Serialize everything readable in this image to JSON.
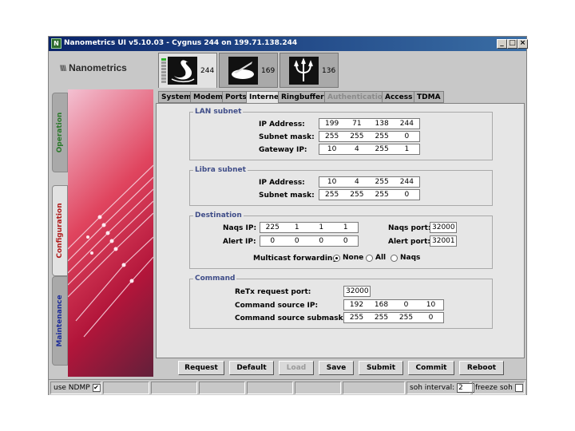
{
  "window": {
    "title": "Nanometrics UI v5.10.03 - Cygnus 244 on 199.71.138.244",
    "controls": {
      "minimize": "_",
      "maximize": "□",
      "close": "×"
    }
  },
  "logo": {
    "text": "Nanometrics",
    "mark": "\\\\\\\\"
  },
  "station_tabs": [
    {
      "number": "244",
      "icon": "swan-icon",
      "active": true
    },
    {
      "number": "169",
      "icon": "sundial-icon",
      "active": false
    },
    {
      "number": "136",
      "icon": "trident-icon",
      "active": false
    }
  ],
  "side_tabs": [
    "Operation",
    "Configuration",
    "Maintenance"
  ],
  "active_side_tab": "Configuration",
  "colors": {
    "operation": "#2d7a2d",
    "configuration": "#b01c1c",
    "maintenance": "#1f2e9a",
    "legend": "#3f4d88"
  },
  "tabs": [
    {
      "label": "System"
    },
    {
      "label": "Modem"
    },
    {
      "label": "Ports"
    },
    {
      "label": "Internet",
      "active": true
    },
    {
      "label": "Ringbuffers"
    },
    {
      "label": "Authentication",
      "disabled": true
    },
    {
      "label": "Access"
    },
    {
      "label": "TDMA"
    }
  ],
  "lan": {
    "title": "LAN subnet",
    "ip_label": "IP Address:",
    "ip": [
      "199",
      "71",
      "138",
      "244"
    ],
    "mask_label": "Subnet mask:",
    "mask": [
      "255",
      "255",
      "255",
      "0"
    ],
    "gw_label": "Gateway IP:",
    "gw": [
      "10",
      "4",
      "255",
      "1"
    ]
  },
  "libra": {
    "title": "Libra subnet",
    "ip_label": "IP Address:",
    "ip": [
      "10",
      "4",
      "255",
      "244"
    ],
    "mask_label": "Subnet mask:",
    "mask": [
      "255",
      "255",
      "255",
      "0"
    ]
  },
  "destination": {
    "title": "Destination",
    "naqs_ip_label": "Naqs IP:",
    "naqs_ip": [
      "225",
      "1",
      "1",
      "1"
    ],
    "alert_ip_label": "Alert IP:",
    "alert_ip": [
      "0",
      "0",
      "0",
      "0"
    ],
    "naqs_port_label": "Naqs port:",
    "naqs_port": "32000",
    "alert_port_label": "Alert port:",
    "alert_port": "32001",
    "multicast_label": "Multicast forwarding:",
    "multicast_options": [
      "None",
      "All",
      "Naqs"
    ],
    "multicast_selected": "None"
  },
  "command": {
    "title": "Command",
    "retx_label": "ReTx request port:",
    "retx_port": "32000",
    "src_ip_label": "Command source IP:",
    "src_ip": [
      "192",
      "168",
      "0",
      "10"
    ],
    "src_mask_label": "Command source submask:",
    "src_mask": [
      "255",
      "255",
      "255",
      "0"
    ]
  },
  "buttons": [
    {
      "label": "Request"
    },
    {
      "label": "Default"
    },
    {
      "label": "Load",
      "disabled": true
    },
    {
      "label": "Save"
    },
    {
      "label": "Submit"
    },
    {
      "label": "Commit"
    },
    {
      "label": "Reboot"
    }
  ],
  "status": {
    "use_ndmp_label": "use NDMP",
    "use_ndmp_checked": true,
    "check_mark": "✔",
    "soh_interval_label": "soh interval:",
    "soh_interval": "2",
    "freeze_soh_label": "freeze soh",
    "freeze_soh_checked": false
  }
}
